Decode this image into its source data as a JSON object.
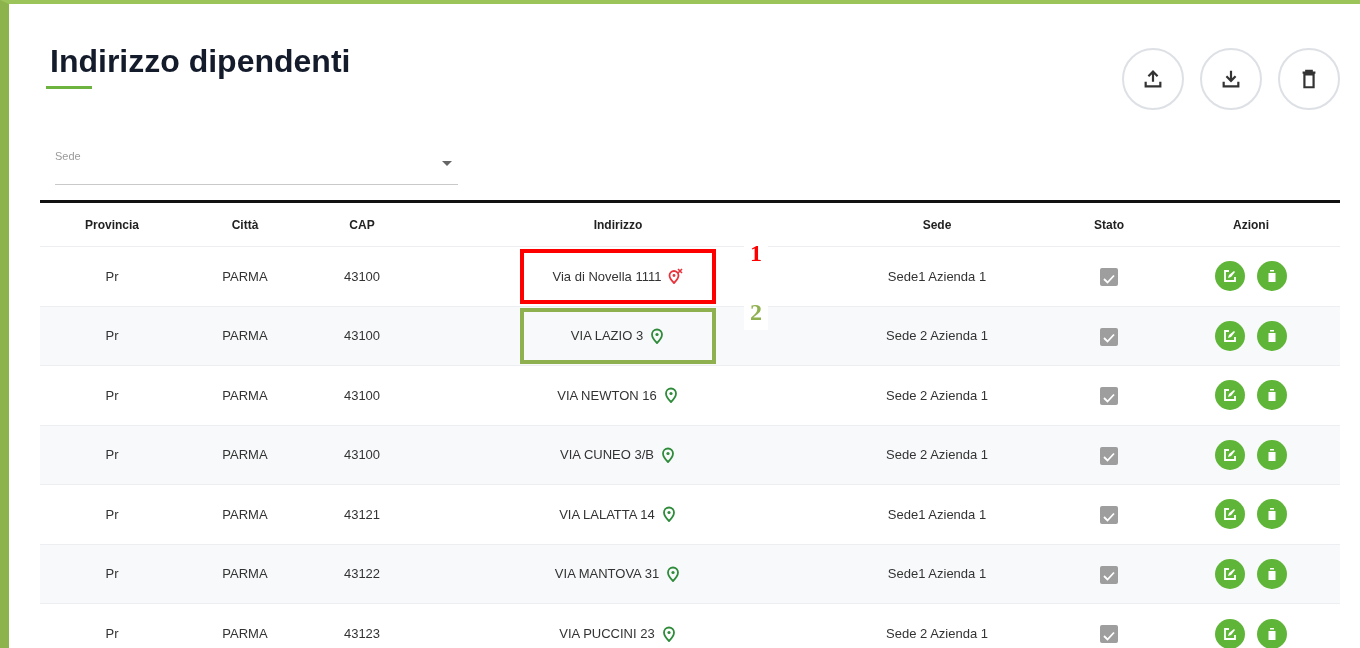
{
  "title": "Indirizzo dipendenti",
  "toolbar": [
    {
      "kind": "upload"
    },
    {
      "kind": "download"
    },
    {
      "kind": "delete"
    }
  ],
  "filter": {
    "label": "Sede"
  },
  "table": {
    "columns": [
      "Provincia",
      "Città",
      "CAP",
      "Indirizzo",
      "Sede",
      "Stato",
      "Azioni"
    ],
    "rows": [
      {
        "provincia": "Pr",
        "citta": "PARMA",
        "cap": "43100",
        "indirizzo": "Via di Novella 1111",
        "located": false,
        "sede": "Sede1 Azienda 1",
        "stato": true,
        "callout": {
          "label": "1",
          "color": "#ff0000"
        }
      },
      {
        "provincia": "Pr",
        "citta": "PARMA",
        "cap": "43100",
        "indirizzo": "VIA LAZIO 3",
        "located": true,
        "sede": "Sede 2 Azienda 1",
        "stato": true,
        "callout": {
          "label": "2",
          "color": "#8fb04f"
        }
      },
      {
        "provincia": "Pr",
        "citta": "PARMA",
        "cap": "43100",
        "indirizzo": "VIA NEWTON 16",
        "located": true,
        "sede": "Sede 2 Azienda 1",
        "stato": true
      },
      {
        "provincia": "Pr",
        "citta": "PARMA",
        "cap": "43100",
        "indirizzo": "VIA CUNEO 3/B",
        "located": true,
        "sede": "Sede 2 Azienda 1",
        "stato": true
      },
      {
        "provincia": "Pr",
        "citta": "PARMA",
        "cap": "43121",
        "indirizzo": "VIA LALATTA 14",
        "located": true,
        "sede": "Sede1 Azienda 1",
        "stato": true
      },
      {
        "provincia": "Pr",
        "citta": "PARMA",
        "cap": "43122",
        "indirizzo": "VIA MANTOVA 31",
        "located": true,
        "sede": "Sede1 Azienda 1",
        "stato": true
      },
      {
        "provincia": "Pr",
        "citta": "PARMA",
        "cap": "43123",
        "indirizzo": "VIA PUCCINI 23",
        "located": true,
        "sede": "Sede 2 Azienda 1",
        "stato": true
      }
    ]
  }
}
